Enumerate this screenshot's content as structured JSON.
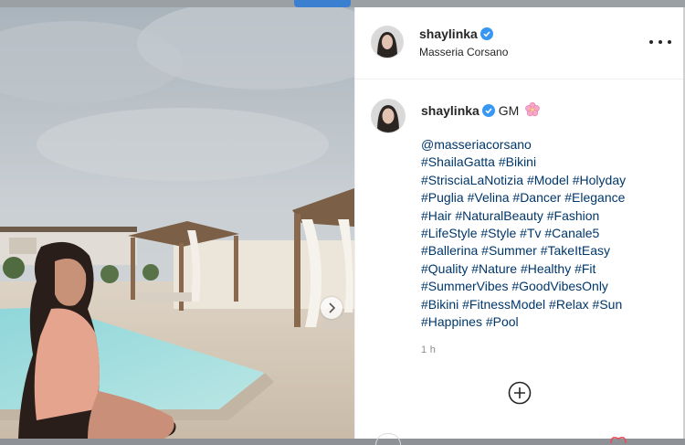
{
  "post": {
    "username": "shaylinka",
    "location": "Masseria Corsano",
    "caption_text": "GM",
    "caption_emoji": "cherry-blossom-emoji",
    "hashtag_lines": [
      "@masseriacorsano",
      "#ShailaGatta #Bikini",
      "#StrisciaLaNotizia #Model #Holyday",
      "#Puglia #Velina #Dancer #Elegance",
      "#Hair #NaturalBeauty #Fashion",
      "#LifeStyle #Style #Tv #Canale5",
      "#Ballerina #Summer #TakeItEasy",
      "#Quality #Nature #Healthy #Fit",
      "#SummerVibes #GoodVibesOnly",
      "#Bikini #FitnessModel #Relax #Sun",
      "#Happines #Pool"
    ],
    "time_ago": "1 h"
  },
  "icons": {
    "verified": "verified-badge-icon",
    "more": "more-options-icon",
    "next": "chevron-right-icon",
    "add_comment": "add-circle-icon",
    "heart": "heart-icon"
  },
  "colors": {
    "link": "#00376b",
    "verified": "#3897f0",
    "text": "#262626",
    "muted": "#8e8e8e"
  }
}
